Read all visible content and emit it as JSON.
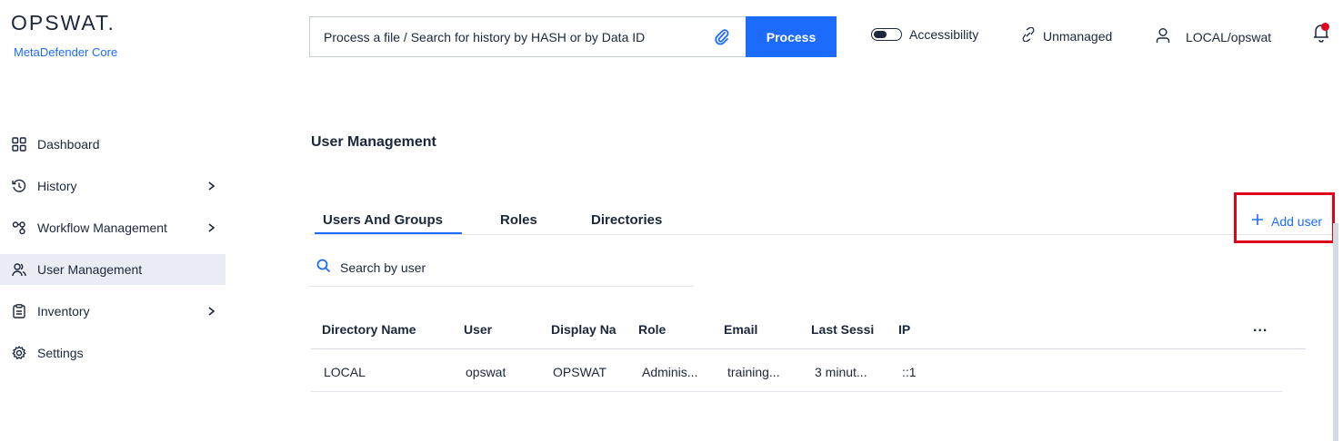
{
  "brand": {
    "name": "OPSWAT.",
    "product": "MetaDefender Core"
  },
  "search": {
    "placeholder": "Process a file / Search for history by HASH or by Data ID",
    "process_label": "Process"
  },
  "toolbar": {
    "accessibility_label": "Accessibility",
    "unmanaged_label": "Unmanaged",
    "user_label": "LOCAL/opswat"
  },
  "sidebar": {
    "items": [
      {
        "label": "Dashboard",
        "icon": "dashboard-icon",
        "chevron": false
      },
      {
        "label": "History",
        "icon": "history-icon",
        "chevron": true
      },
      {
        "label": "Workflow Management",
        "icon": "workflow-icon",
        "chevron": true
      },
      {
        "label": "User Management",
        "icon": "users-icon",
        "chevron": false,
        "active": true
      },
      {
        "label": "Inventory",
        "icon": "inventory-icon",
        "chevron": true
      },
      {
        "label": "Settings",
        "icon": "gear-icon",
        "chevron": false
      }
    ]
  },
  "main": {
    "title": "User Management",
    "tabs": [
      {
        "label": "Users And Groups",
        "active": true
      },
      {
        "label": "Roles"
      },
      {
        "label": "Directories"
      }
    ],
    "add_user_label": "Add user",
    "search_placeholder": "Search by user",
    "table": {
      "columns": [
        "Directory Name",
        "User",
        "Display Na",
        "Role",
        "Email",
        "Last Sessi",
        "IP"
      ],
      "more_label": "...",
      "rows": [
        [
          "LOCAL",
          "opswat",
          "OPSWAT",
          "Adminis...",
          "training...",
          "3 minut...",
          "::1"
        ]
      ]
    }
  },
  "colors": {
    "accent": "#1d6bfc",
    "highlight": "#e0021a",
    "text": "#1b273a",
    "active_bg": "#e9ecf2"
  }
}
